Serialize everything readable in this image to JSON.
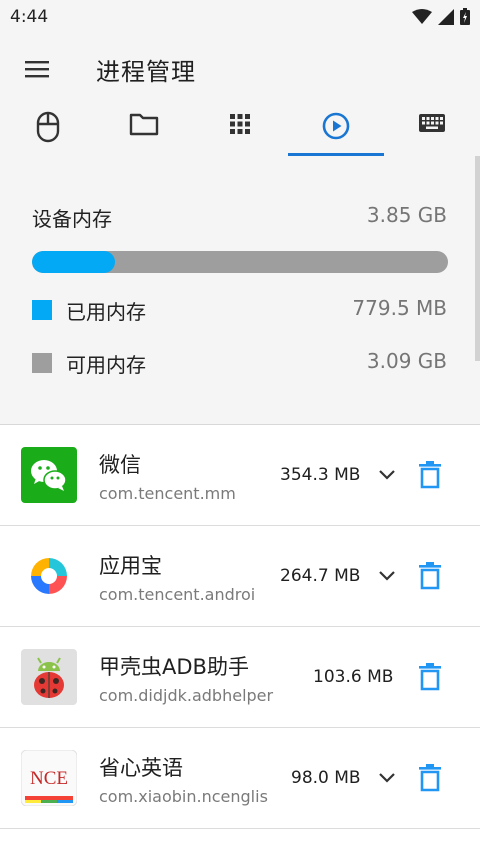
{
  "status_bar": {
    "time": "4:44"
  },
  "toolbar": {
    "title": "进程管理"
  },
  "tabs": [
    {
      "icon": "mouse-icon"
    },
    {
      "icon": "folder-icon"
    },
    {
      "icon": "apps-grid-icon"
    },
    {
      "icon": "play-circle-icon",
      "active": true
    },
    {
      "icon": "keyboard-icon"
    }
  ],
  "memory": {
    "title": "设备内存",
    "total": "3.85 GB",
    "used_label": "已用内存",
    "used_value": "779.5 MB",
    "free_label": "可用内存",
    "free_value": "3.09 GB",
    "used_fraction": 0.2,
    "used_color": "#03a9f4",
    "free_color": "#9e9e9e"
  },
  "processes": [
    {
      "name": "微信",
      "package": "com.tencent.mm",
      "size": "354.3 MB",
      "icon": "wechat-icon"
    },
    {
      "name": "应用宝",
      "package": "com.tencent.androi",
      "size": "264.7 MB",
      "icon": "yingyongbao-icon"
    },
    {
      "name": "甲壳虫ADB助手",
      "package": "com.didjdk.adbhelper",
      "size": "103.6 MB",
      "icon": "ladybug-android-icon"
    },
    {
      "name": "省心英语",
      "package": "com.xiaobin.ncenglis",
      "size": "98.0 MB",
      "icon": "nce-icon",
      "icon_text": "NCE"
    }
  ],
  "colors": {
    "accent": "#1976d2",
    "trash": "#2196f3"
  }
}
